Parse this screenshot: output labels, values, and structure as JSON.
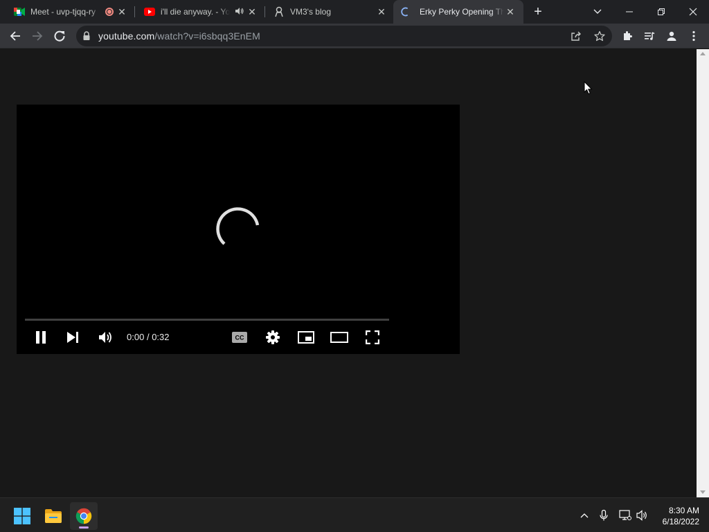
{
  "browser": {
    "tabs": [
      {
        "title": "Meet - uvp-tjqq-ry",
        "favicon": "google-meet-icon",
        "indicator": "recording-icon"
      },
      {
        "title": "i'll die anyway. - Yo",
        "favicon": "youtube-icon",
        "indicator": "speaker-icon"
      },
      {
        "title": "VM3's blog",
        "favicon": "blog-icon"
      },
      {
        "title": "Erky Perky Opening Th",
        "favicon": "loading-spinner-icon",
        "active": true
      }
    ],
    "url_host": "youtube.com",
    "url_path": "/watch?v=i6sbqq3EnEM"
  },
  "player": {
    "current_time": "0:00",
    "separator": "/",
    "duration": "0:32",
    "progress_fraction": 0,
    "state": "loading"
  },
  "taskbar": {
    "time": "8:30 AM",
    "date": "6/18/2022"
  },
  "colors": {
    "page_bg": "#181818",
    "player_bg": "#000000",
    "tab_strip": "#202124",
    "toolbar": "#35363a",
    "accent_chrome_loading": "#8ab4f8"
  }
}
